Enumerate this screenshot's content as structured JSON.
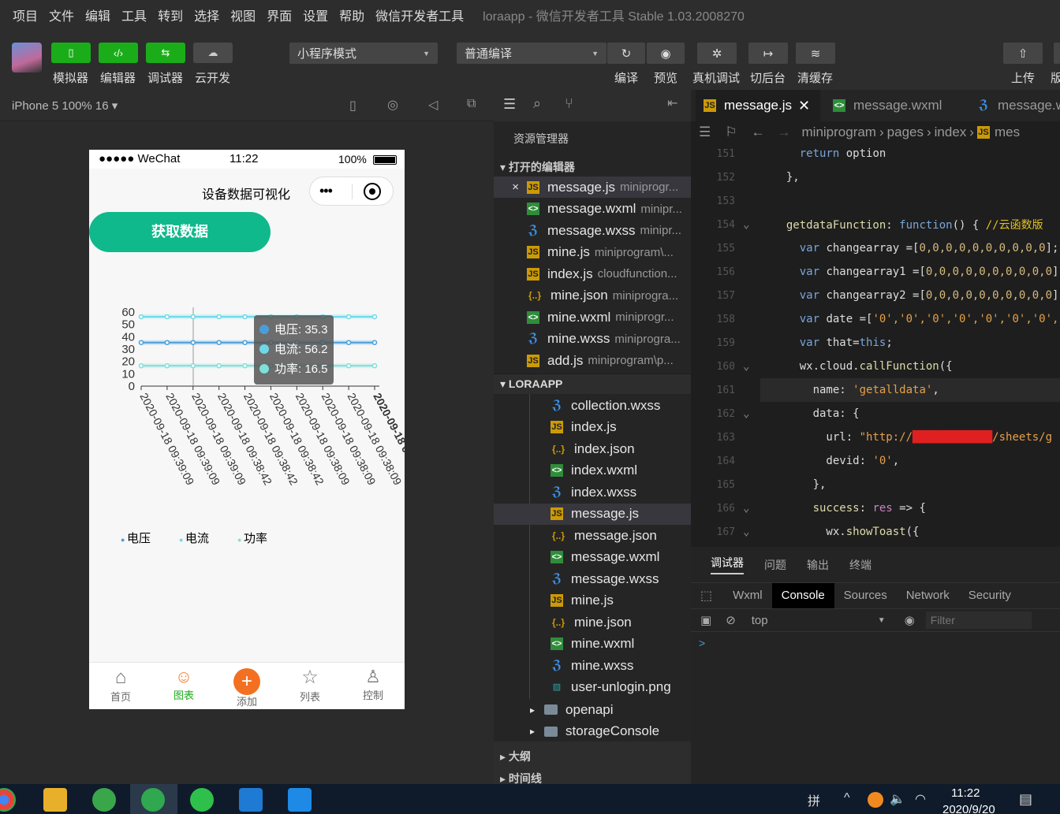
{
  "menu": [
    "项目",
    "文件",
    "编辑",
    "工具",
    "转到",
    "选择",
    "视图",
    "界面",
    "设置",
    "帮助",
    "微信开发者工具"
  ],
  "window_title": "loraapp - 微信开发者工具 Stable 1.03.2008270",
  "toolbar": {
    "simulator": "模拟器",
    "editor": "编辑器",
    "debugger": "调试器",
    "cloud": "云开发",
    "mode": "小程序模式",
    "compile_mode": "普通编译",
    "compile": "编译",
    "preview": "预览",
    "real_debug": "真机调试",
    "background": "切后台",
    "clear_cache": "清缓存",
    "upload": "上传",
    "version": "版"
  },
  "sim": {
    "device": "iPhone 5 100% 16 ▾",
    "status": {
      "carrier": "●●●●● WeChat",
      "time": "11:22",
      "battery": "100%"
    },
    "nav_title": "设备数据可视化",
    "fetch_button": "获取数据",
    "tabs": [
      {
        "label": "首页"
      },
      {
        "label": "图表",
        "active": true
      },
      {
        "label": "添加"
      },
      {
        "label": "列表"
      },
      {
        "label": "控制"
      }
    ]
  },
  "chart_data": {
    "type": "line",
    "x": [
      "2020-09-18 09:39:09",
      "2020-09-18 09:39:09",
      "2020-09-18 09:39:09",
      "2020-09-18 09:38:42",
      "2020-09-18 09:38:42",
      "2020-09-18 09:38:42",
      "2020-09-18 09:38:09",
      "2020-09-18 09:38:09",
      "2020-09-18 09:38:09",
      "2020-09-18 09:38:0"
    ],
    "series": [
      {
        "name": "电压",
        "color": "#4a9ed8",
        "values": [
          35.3,
          35.3,
          35.3,
          35.3,
          35.3,
          35.3,
          35.3,
          35.3,
          35.3,
          35.3
        ]
      },
      {
        "name": "电流",
        "color": "#6ed8e8",
        "values": [
          56.2,
          56.2,
          56.2,
          56.2,
          56.2,
          56.2,
          56.2,
          56.2,
          56.2,
          56.2
        ]
      },
      {
        "name": "功率",
        "color": "#7ee0d8",
        "values": [
          16.5,
          16.5,
          16.5,
          16.5,
          16.5,
          16.5,
          16.5,
          16.5,
          16.5,
          16.5
        ]
      }
    ],
    "yticks": [
      "0",
      "10",
      "20",
      "30",
      "40",
      "50",
      "60"
    ],
    "ylim": [
      0,
      60
    ],
    "tooltip": [
      "电压: 35.3",
      "电流: 56.2",
      "功率: 16.5"
    ]
  },
  "explorer": {
    "tabs_title": "资源管理器",
    "open_editors": "打开的编辑器",
    "open_files": [
      {
        "name": "message.js",
        "path": "miniprogr...",
        "type": "js",
        "close": "×"
      },
      {
        "name": "message.wxml",
        "path": "minipr...",
        "type": "wxml"
      },
      {
        "name": "message.wxss",
        "path": "minipr...",
        "type": "wxss"
      },
      {
        "name": "mine.js",
        "path": "miniprogram\\...",
        "type": "js"
      },
      {
        "name": "index.js",
        "path": "cloudfunction...",
        "type": "js"
      },
      {
        "name": "mine.json",
        "path": "miniprogra...",
        "type": "json"
      },
      {
        "name": "mine.wxml",
        "path": "miniprogr...",
        "type": "wxml"
      },
      {
        "name": "mine.wxss",
        "path": "miniprogra...",
        "type": "wxss"
      },
      {
        "name": "add.js",
        "path": "miniprogram\\p...",
        "type": "js"
      }
    ],
    "project": "LORAAPP",
    "tree": [
      {
        "name": "collection.wxss",
        "type": "wxss"
      },
      {
        "name": "index.js",
        "type": "js"
      },
      {
        "name": "index.json",
        "type": "json"
      },
      {
        "name": "index.wxml",
        "type": "wxml"
      },
      {
        "name": "index.wxss",
        "type": "wxss"
      },
      {
        "name": "message.js",
        "type": "js",
        "selected": true
      },
      {
        "name": "message.json",
        "type": "json"
      },
      {
        "name": "message.wxml",
        "type": "wxml"
      },
      {
        "name": "message.wxss",
        "type": "wxss"
      },
      {
        "name": "mine.js",
        "type": "js"
      },
      {
        "name": "mine.json",
        "type": "json"
      },
      {
        "name": "mine.wxml",
        "type": "wxml"
      },
      {
        "name": "mine.wxss",
        "type": "wxss"
      },
      {
        "name": "user-unlogin.png",
        "type": "png"
      }
    ],
    "folders": [
      "openapi",
      "storageConsole"
    ],
    "outline": "大纲",
    "timeline": "时间线"
  },
  "editor": {
    "tabs": [
      {
        "name": "message.js",
        "active": true
      },
      {
        "name": "message.wxml"
      },
      {
        "name": "message.w"
      }
    ],
    "breadcrumb": [
      "miniprogram",
      "pages",
      "index",
      "mes"
    ],
    "lines": [
      {
        "n": "151",
        "html": "    <span class='k'>return</span> option"
      },
      {
        "n": "152",
        "html": "  },"
      },
      {
        "n": "153",
        "html": ""
      },
      {
        "n": "154",
        "html": "  <span class='f'>getdataFunction</span>: <span class='k'>function</span>() { <span class='c'>//云函数版</span>"
      },
      {
        "n": "155",
        "html": "    <span class='k'>var</span> changearray =[<span class='n'>0,0,0,0,0,0,0,0,0,0</span>];"
      },
      {
        "n": "156",
        "html": "    <span class='k'>var</span> changearray1 =[<span class='n'>0,0,0,0,0,0,0,0,0,0</span>];"
      },
      {
        "n": "157",
        "html": "    <span class='k'>var</span> changearray2 =[<span class='n'>0,0,0,0,0,0,0,0,0,0</span>];"
      },
      {
        "n": "158",
        "html": "    <span class='k'>var</span> date =[<span class='s'>'0','0','0','0','0','0','0','0'</span>"
      },
      {
        "n": "159",
        "html": "    <span class='k'>var</span> that=<span class='k'>this</span>;"
      },
      {
        "n": "160",
        "html": "    wx.cloud.<span class='f'>callFunction</span>({"
      },
      {
        "n": "161",
        "html": "      name: <span class='s'>'getalldata'</span>,"
      },
      {
        "n": "162",
        "html": "      data: {"
      },
      {
        "n": "163",
        "html": "        url: <span class='s'>\"http://</span><span style='color:#e02020'>████████████</span><span class='s'>/sheets/g</span>"
      },
      {
        "n": "164",
        "html": "        devid: <span class='s'>'0'</span>,"
      },
      {
        "n": "165",
        "html": "      },"
      },
      {
        "n": "166",
        "html": "      <span class='f'>success</span>: <span class='p'>res</span> => {"
      },
      {
        "n": "167",
        "html": "        wx.<span class='f'>showToast</span>({"
      }
    ]
  },
  "debug": {
    "tabs": [
      "调试器",
      "问题",
      "输出",
      "终端"
    ],
    "devtabs": [
      "Wxml",
      "Console",
      "Sources",
      "Network",
      "Security"
    ],
    "context": "top",
    "filter_placeholder": "Filter",
    "prompt": ">"
  },
  "taskbar": {
    "time": "11:22",
    "date": "2020/9/20",
    "ime": "拼"
  }
}
